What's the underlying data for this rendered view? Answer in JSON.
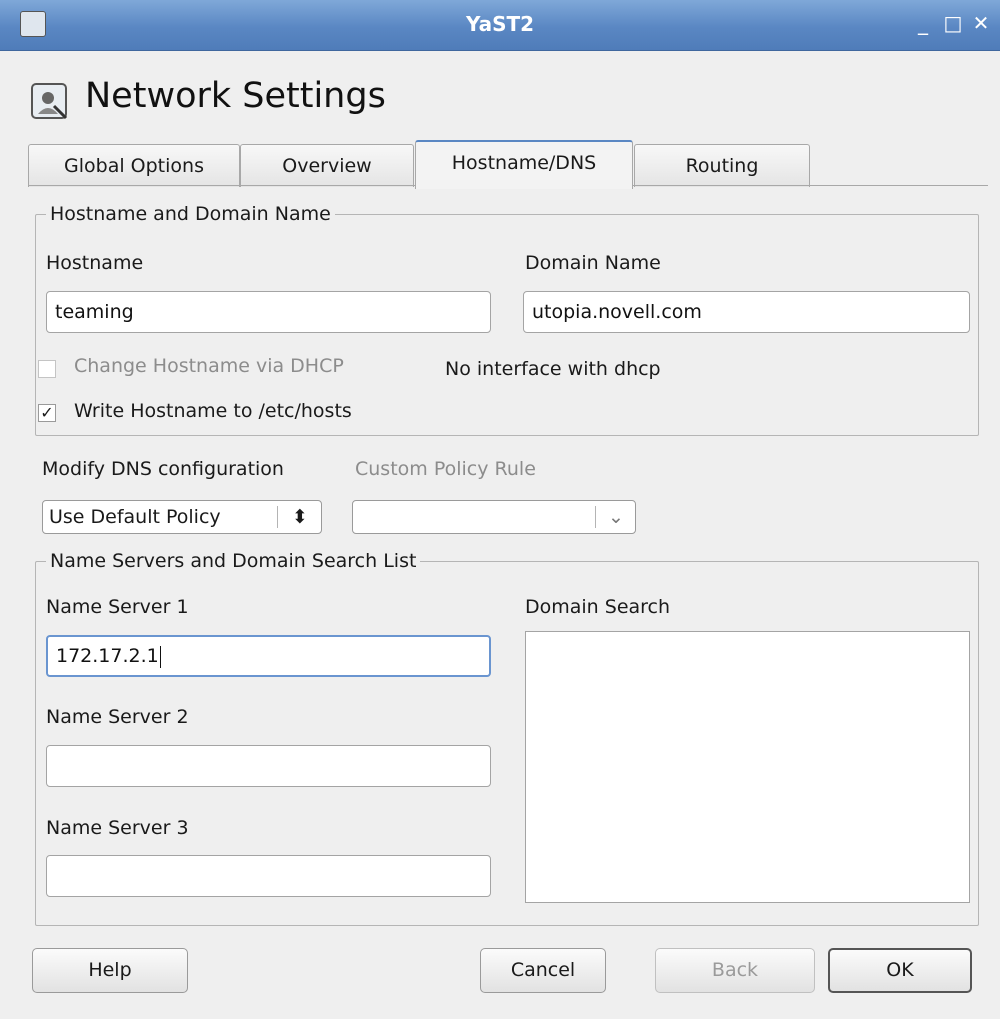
{
  "window": {
    "title": "YaST2",
    "minimize": "_",
    "maximize": "□",
    "close": "✕"
  },
  "page": {
    "title": "Network Settings"
  },
  "tabs": [
    {
      "label": "Global Options"
    },
    {
      "label": "Overview"
    },
    {
      "label": "Hostname/DNS"
    },
    {
      "label": "Routing"
    }
  ],
  "hostname_group": {
    "legend": "Hostname and Domain Name",
    "hostname_label": "Hostname",
    "hostname_value": "teaming",
    "domain_label": "Domain Name",
    "domain_value": "utopia.novell.com",
    "dhcp_checkbox_label": "Change Hostname via DHCP",
    "dhcp_checked": false,
    "dhcp_status": "No interface with dhcp",
    "hosts_checkbox_label": "Write Hostname to /etc/hosts",
    "hosts_checked": true,
    "check_mark": "✓"
  },
  "dns_config": {
    "modify_label": "Modify DNS configuration",
    "modify_value": "Use Default Policy",
    "custom_rule_label": "Custom Policy Rule",
    "custom_rule_value": ""
  },
  "nameservers_group": {
    "legend": "Name Servers and Domain Search List",
    "ns1_label": "Name Server 1",
    "ns1_value": "172.17.2.1",
    "ns2_label": "Name Server 2",
    "ns2_value": "",
    "ns3_label": "Name Server 3",
    "ns3_value": "",
    "domain_search_label": "Domain Search"
  },
  "buttons": {
    "help": "Help",
    "cancel": "Cancel",
    "back": "Back",
    "ok": "OK"
  },
  "colors": {
    "titlebar": "#5a87c3",
    "focus": "#6a95d0"
  }
}
